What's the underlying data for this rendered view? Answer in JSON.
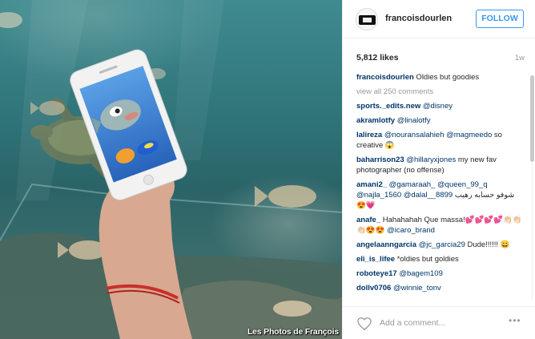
{
  "photo": {
    "watermark": "Les Photos de François"
  },
  "post": {
    "username": "francoisdourlen",
    "follow_label": "FOLLOW",
    "likes": "5,812 likes",
    "age": "1w",
    "caption_user": "francoisdourlen",
    "caption_text": " Oldies but goodies",
    "view_all": "view all 250 comments",
    "comments": [
      {
        "user": "sports._edits.new",
        "mention": " @disney",
        "text": ""
      },
      {
        "user": "akramlotfy",
        "mention": " @linalotfy",
        "text": ""
      },
      {
        "user": "lalireza",
        "mention": " @nouransalahieh @magmeedo",
        "text": " so creative 😱"
      },
      {
        "user": "baharrison23",
        "mention": " @hillaryxjones",
        "text": " my new fav photographer (no offense)"
      },
      {
        "user": "amani2_",
        "mention": " @gamaraah_ @queen_99_q @najla_1560 @dalal__8899",
        "text": " شوفو حسابه رهيب 😍💗"
      },
      {
        "user": "anafe_",
        "mention": "",
        "text": " Hahahahah Que massa!💕💕💕💕👏🏻👏🏻👏🏻😍😍",
        "mention2": " @icaro_brand"
      },
      {
        "user": "angelaanngarcia",
        "mention": " @jc_garcia29",
        "text": " Dude!!!!!! 😄"
      },
      {
        "user": "eli_is_lifee",
        "mention": "",
        "text": " *oldies but goldies"
      },
      {
        "user": "roboteye17",
        "mention": " @bagem109",
        "text": ""
      },
      {
        "user": "dollv0706",
        "mention": " @winnie_tonv",
        "text": ""
      }
    ],
    "add_comment_placeholder": "Add a comment...",
    "more_label": "•••"
  },
  "icons": {
    "heart": "heart-icon",
    "more": "more-options-icon",
    "avatar": "avatar"
  },
  "colors": {
    "accent": "#3897f0",
    "link": "#003569",
    "muted": "#999999"
  }
}
